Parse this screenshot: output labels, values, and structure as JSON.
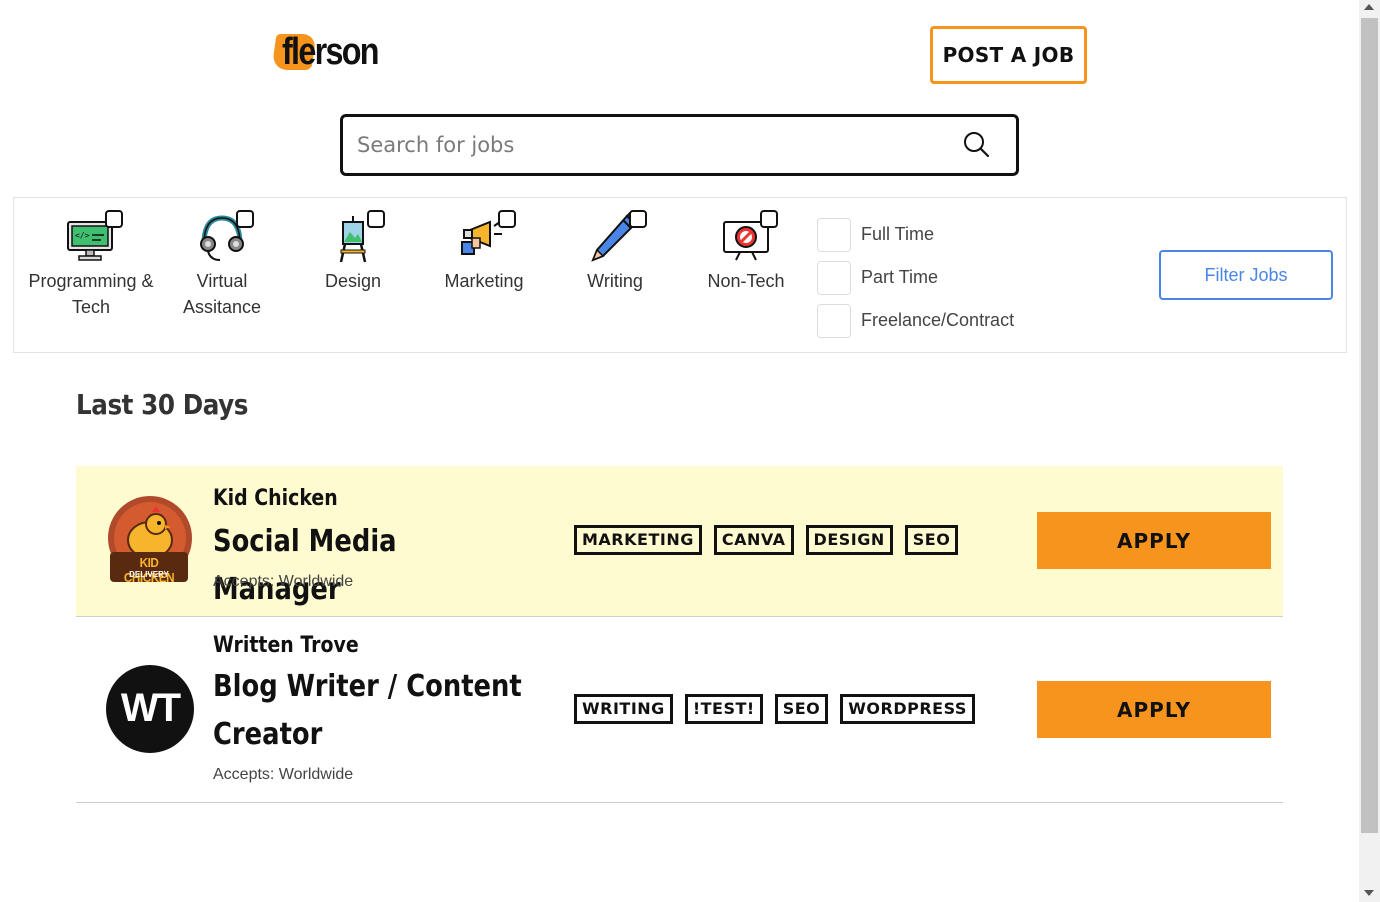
{
  "header": {
    "logo_text": "flerson",
    "post_job_label": "POST A JOB",
    "search_placeholder": "Search for jobs"
  },
  "filters": {
    "categories": [
      {
        "label": "Programming & Tech",
        "icon": "computer-code-icon"
      },
      {
        "label": "Virtual Assitance",
        "icon": "headset-icon"
      },
      {
        "label": "Design",
        "icon": "easel-icon"
      },
      {
        "label": "Marketing",
        "icon": "megaphone-icon"
      },
      {
        "label": "Writing",
        "icon": "pencil-icon"
      },
      {
        "label": "Non-Tech",
        "icon": "no-computer-icon"
      }
    ],
    "job_types": [
      "Full Time",
      "Part Time",
      "Freelance/Contract"
    ],
    "filter_button_label": "Filter Jobs"
  },
  "section_title": "Last 30 Days",
  "jobs": [
    {
      "company": "Kid Chicken",
      "logo_text": "KID CHICKEN",
      "logo_subtext": "DELIVERY",
      "title": "Social Media Manager",
      "accepts": "Accepts: Worldwide",
      "tags": [
        "MARKETING",
        "CANVA",
        "DESIGN",
        "SEO"
      ],
      "apply_label": "APPLY",
      "featured": true
    },
    {
      "company": "Written Trove",
      "logo_text": "WT",
      "title": "Blog Writer / Content Creator",
      "accepts": "Accepts: Worldwide",
      "tags": [
        "WRITING",
        "!TEST!",
        "SEO",
        "WORDPRESS"
      ],
      "apply_label": "APPLY",
      "featured": false
    }
  ],
  "colors": {
    "accent_orange": "#f7941d",
    "featured_bg": "#fffbd0",
    "filter_blue": "#4a86e8"
  }
}
